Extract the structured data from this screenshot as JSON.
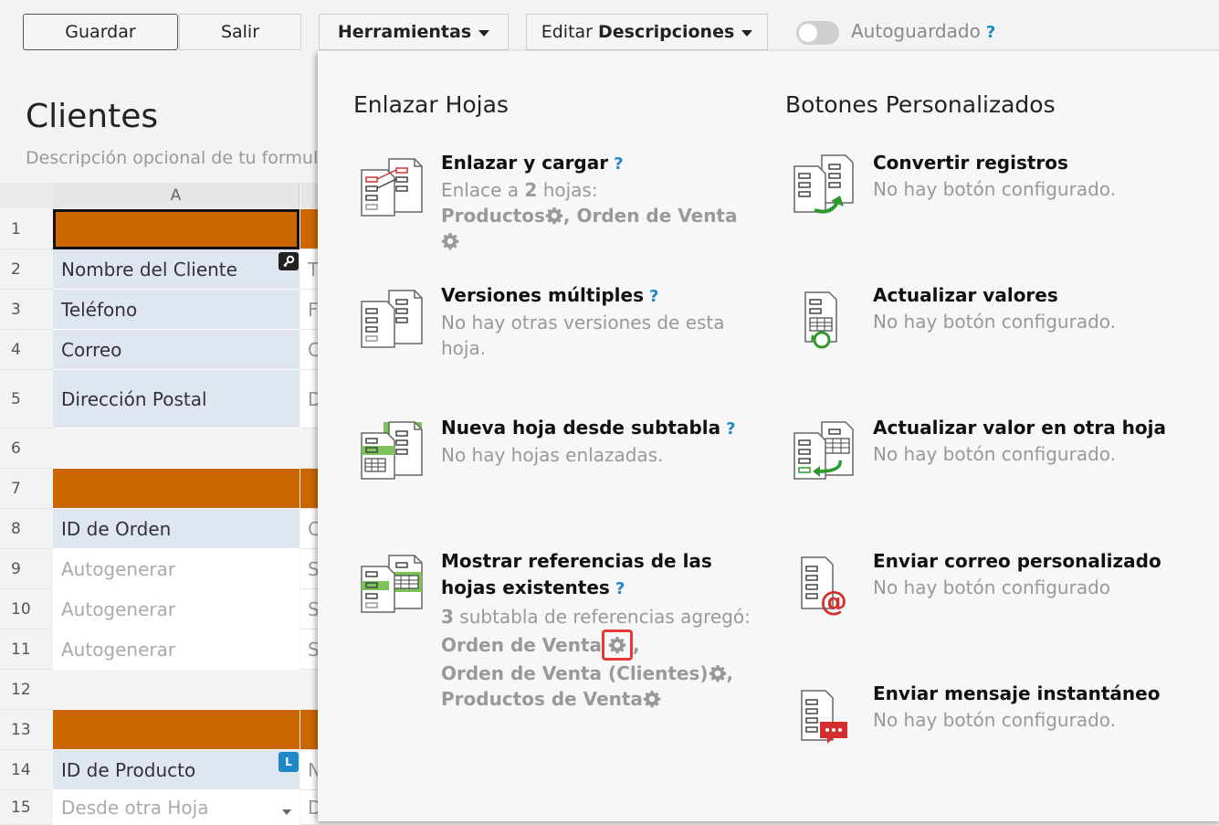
{
  "toolbar": {
    "save_label": "Guardar",
    "exit_label": "Salir",
    "tools_label": "Herramientas",
    "edit_prefix": "Editar",
    "edit_bold": "Descripciones",
    "autosave_label": "Autoguardado",
    "help_mark": "?"
  },
  "sheet": {
    "title": "Clientes",
    "description": "Descripción opcional de tu formulario",
    "column_a": "A",
    "rows": [
      {
        "num": "1",
        "text": ""
      },
      {
        "num": "2",
        "text": "Nombre del Cliente",
        "col_b": "T"
      },
      {
        "num": "3",
        "text": "Teléfono",
        "col_b": "F"
      },
      {
        "num": "4",
        "text": "Correo",
        "col_b": "C"
      },
      {
        "num": "5",
        "text": "Dirección Postal",
        "col_b": "D"
      },
      {
        "num": "6",
        "text": ""
      },
      {
        "num": "7",
        "text": ""
      },
      {
        "num": "8",
        "text": "ID de Orden",
        "col_b": "C"
      },
      {
        "num": "9",
        "text": "Autogenerar",
        "col_b": "S"
      },
      {
        "num": "10",
        "text": "Autogenerar",
        "col_b": "S"
      },
      {
        "num": "11",
        "text": "Autogenerar",
        "col_b": "S"
      },
      {
        "num": "12",
        "text": ""
      },
      {
        "num": "13",
        "text": ""
      },
      {
        "num": "14",
        "text": "ID de Producto",
        "col_b": "N"
      },
      {
        "num": "15",
        "text": "Desde otra Hoja",
        "col_b": "D"
      }
    ],
    "key_badge": "🔑",
    "l_badge": "L"
  },
  "panel": {
    "left_title": "Enlazar Hojas",
    "right_title": "Botones Personalizados",
    "link": {
      "title": "Enlazar y cargar",
      "desc_prefix": "Enlace a",
      "desc_count": "2",
      "desc_suffix": "hojas:",
      "sheet1": "Productos",
      "sheet2": "Orden de Venta"
    },
    "versions": {
      "title": "Versiones múltiples",
      "desc": "No hay otras versiones de esta hoja."
    },
    "subtable": {
      "title": "Nueva hoja desde subtabla",
      "desc": "No hay hojas enlazadas."
    },
    "references": {
      "title_line1": "Mostrar referencias de las",
      "title_line2": "hojas existentes",
      "desc_count": "3",
      "desc_suffix": "subtabla de referencias agregó:",
      "ref1": "Orden de Venta",
      "ref2": "Orden de Venta (Clientes)",
      "ref3": "Productos de Venta"
    },
    "buttons": [
      {
        "title": "Convertir registros",
        "desc": "No hay botón configurado."
      },
      {
        "title": "Actualizar valores",
        "desc": "No hay botón configurado."
      },
      {
        "title": "Actualizar valor en otra hoja",
        "desc": "No hay botón configurado."
      },
      {
        "title": "Enviar correo personalizado",
        "desc": "No hay botón configurado"
      },
      {
        "title": "Enviar mensaje instantáneo",
        "desc": "No hay botón configurado."
      }
    ]
  },
  "colors": {
    "accent_blue": "#1e88c8",
    "header_orange": "#cc6600",
    "highlight_red": "#e53935",
    "green": "#2e9a2e"
  }
}
